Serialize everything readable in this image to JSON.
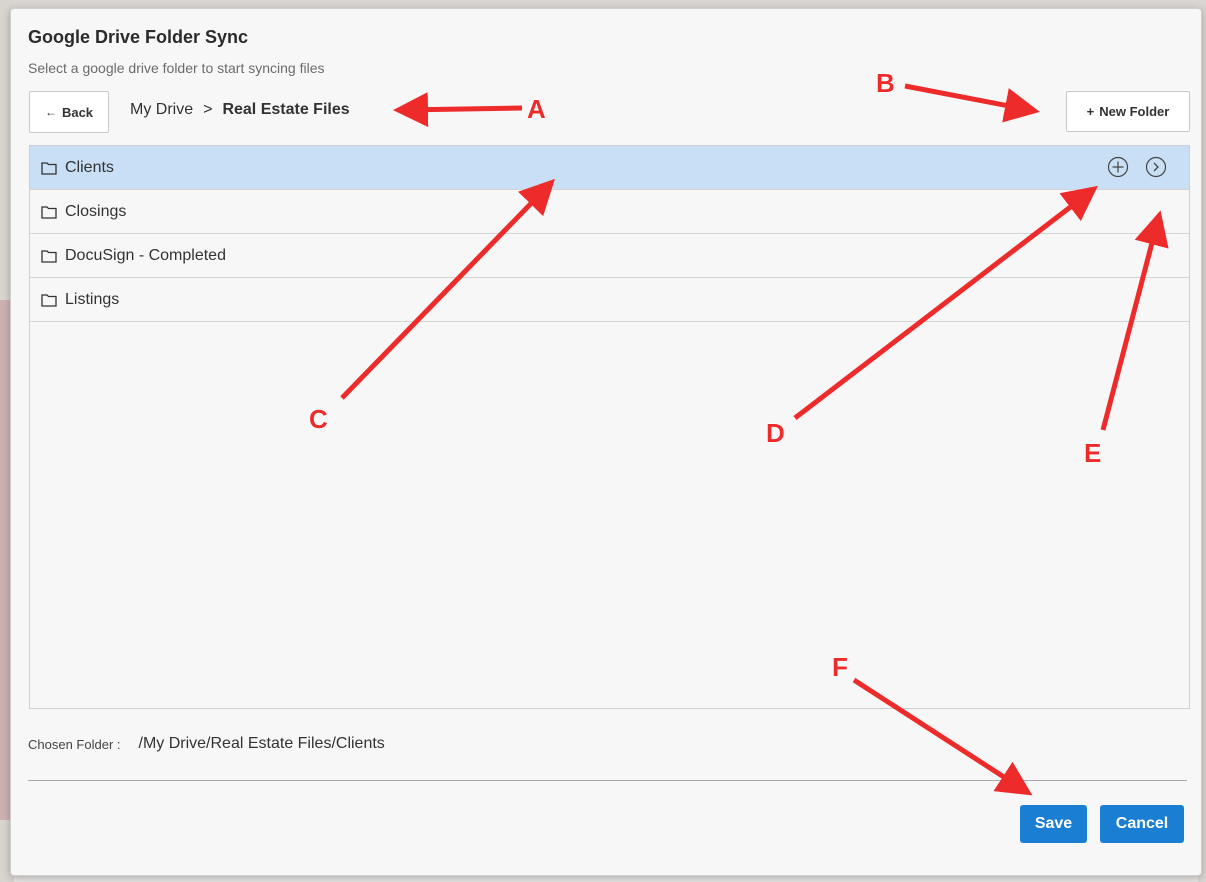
{
  "dialog": {
    "title": "Google Drive Folder Sync",
    "subtitle": "Select a google drive folder to start syncing files"
  },
  "toolbar": {
    "back_label": "Back",
    "back_icon": "arrow-left-icon",
    "new_folder_label": "New Folder",
    "new_folder_icon": "plus-icon"
  },
  "breadcrumb": {
    "root": "My Drive",
    "separator": ">",
    "current": "Real Estate Files"
  },
  "folders": [
    {
      "name": "Clients",
      "selected": true
    },
    {
      "name": "Closings",
      "selected": false
    },
    {
      "name": "DocuSign - Completed",
      "selected": false
    },
    {
      "name": "Listings",
      "selected": false
    }
  ],
  "row_actions": {
    "select_icon": "circle-plus-icon",
    "open_icon": "circle-chevron-right-icon"
  },
  "chosen": {
    "label": "Chosen Folder :",
    "value": "/My Drive/Real Estate Files/Clients"
  },
  "footer": {
    "save_label": "Save",
    "cancel_label": "Cancel"
  },
  "annotations": {
    "A": "A",
    "B": "B",
    "C": "C",
    "D": "D",
    "E": "E",
    "F": "F"
  },
  "colors": {
    "primary": "#1a7fd3",
    "selected_row": "#c9dff5",
    "annotation_red": "#ee2b2b"
  }
}
